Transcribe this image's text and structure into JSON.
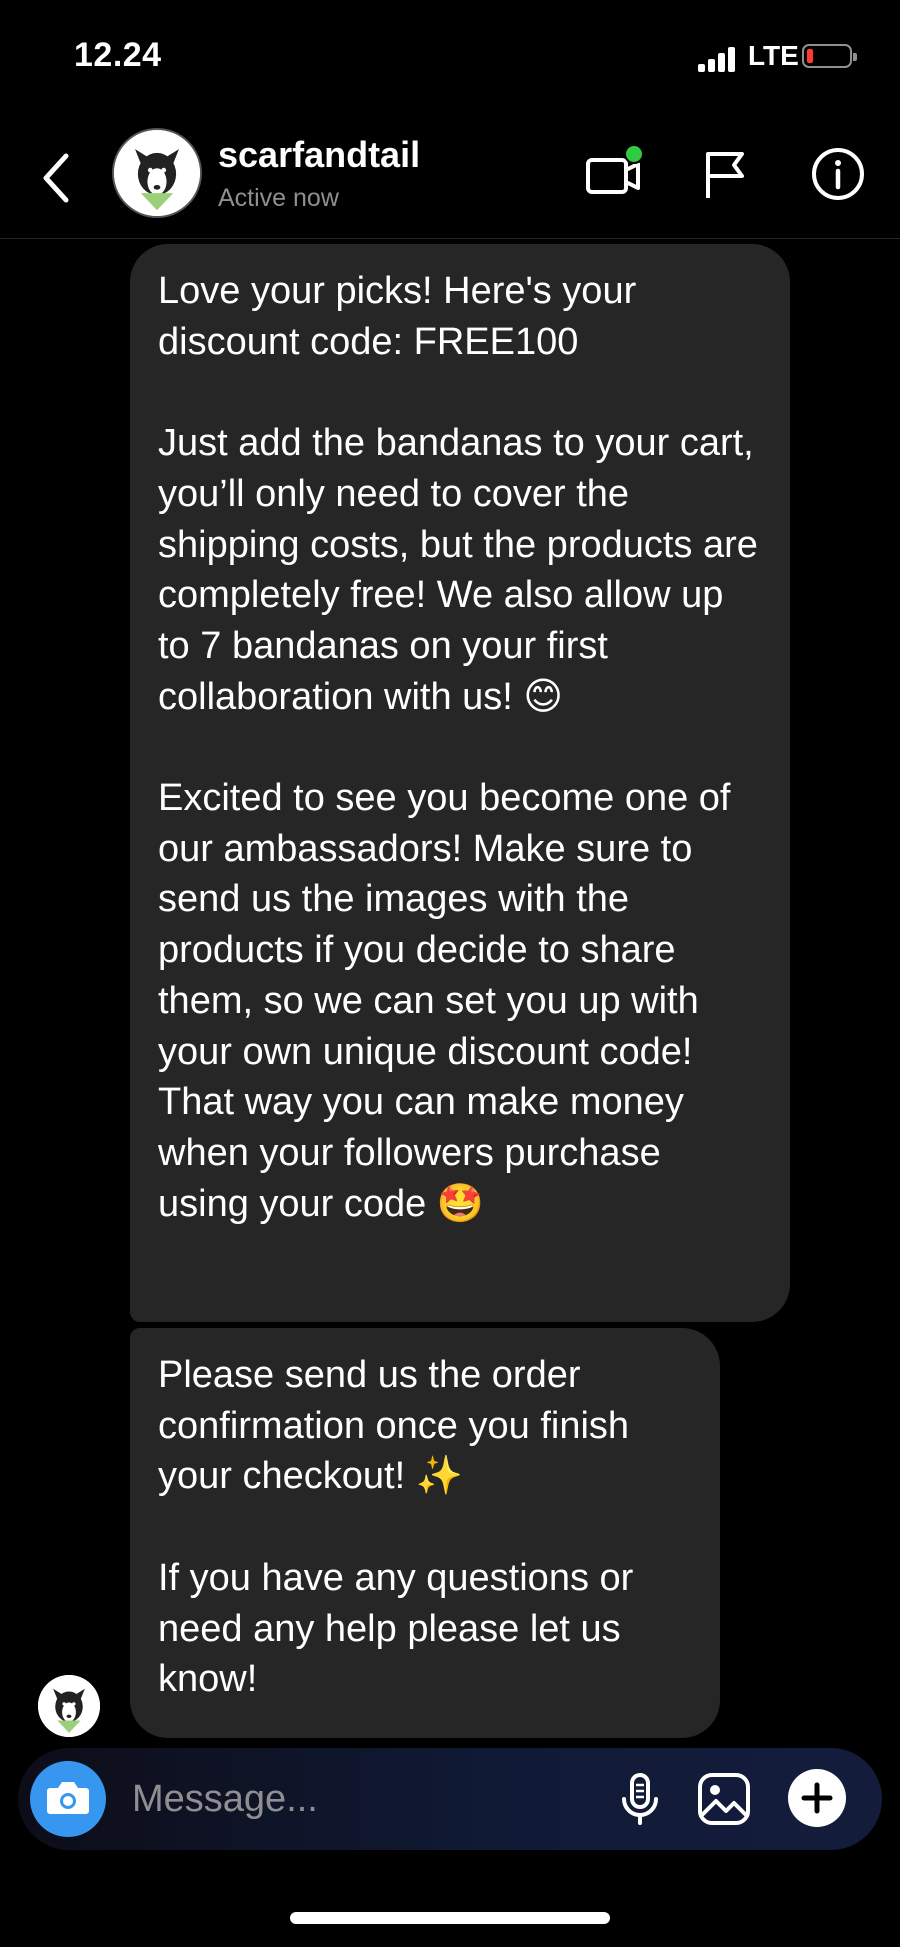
{
  "status_bar": {
    "time": "12.24",
    "network": "LTE",
    "battery_level": 0.1,
    "battery_color": "#ff3b30"
  },
  "header": {
    "username": "scarfandtail",
    "status": "Active now",
    "icons": [
      "back-arrow-icon",
      "video-call-icon",
      "flag-icon",
      "info-icon"
    ],
    "active_dot_color": "#2ecc40"
  },
  "messages": [
    {
      "sender": "scarfandtail",
      "text": "Love your picks! Here's your discount code: FREE100\n\nJust add the bandanas to your cart, you’ll only need to cover the shipping costs, but the products are completely free! We also allow up to 7 bandanas on your first collaboration with us! 😊\n\nExcited to see you become one of our ambassadors! Make sure to send us the images with the products if you decide to share them, so we can set you up with your own unique discount code! That way you can make money when your followers purchase using your code 🤩"
    },
    {
      "sender": "scarfandtail",
      "text": "Please send us the order confirmation once you finish your checkout! ✨\n\nIf you have any questions or need any help please let us know!"
    }
  ],
  "composer": {
    "placeholder": "Message...",
    "value": "",
    "icons": [
      "camera-icon",
      "microphone-icon",
      "gallery-icon",
      "plus-icon"
    ],
    "camera_color": "#3797f0"
  },
  "colors": {
    "bubble": "#262626",
    "background": "#000000",
    "secondary_text": "#8e8e93"
  }
}
